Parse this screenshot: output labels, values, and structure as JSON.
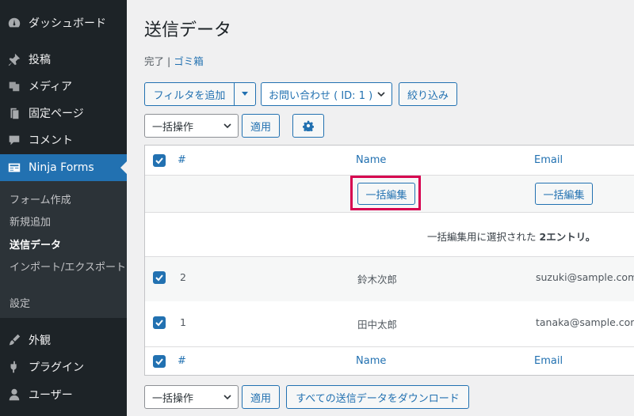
{
  "sidebar": {
    "items_top": [
      {
        "label": "ダッシュボード",
        "icon": "dashboard-icon"
      }
    ],
    "items": [
      {
        "label": "投稿",
        "icon": "pin-icon"
      },
      {
        "label": "メディア",
        "icon": "media-icon"
      },
      {
        "label": "固定ページ",
        "icon": "page-icon"
      },
      {
        "label": "コメント",
        "icon": "comment-icon"
      },
      {
        "label": "Ninja Forms",
        "icon": "forms-icon"
      }
    ],
    "submenu": [
      {
        "label": "フォーム作成"
      },
      {
        "label": "新規追加"
      },
      {
        "label": "送信データ"
      },
      {
        "label": "インポート/エクスポート"
      },
      {
        "label": "設定"
      }
    ],
    "items_bottom": [
      {
        "label": "外観",
        "icon": "brush-icon"
      },
      {
        "label": "プラグイン",
        "icon": "plugin-icon"
      },
      {
        "label": "ユーザー",
        "icon": "user-icon"
      }
    ]
  },
  "page": {
    "title": "送信データ",
    "status_done": "完了",
    "separator": "|",
    "status_trash": "ゴミ箱"
  },
  "filters": {
    "add_filter": "フィルタを追加",
    "form_select": "お問い合わせ ( ID: 1 )",
    "filter_button": "絞り込み",
    "bulk_select": "一括操作",
    "apply_button": "適用"
  },
  "table": {
    "headers": {
      "num": "#",
      "name": "Name",
      "email": "Email"
    },
    "bulk_edit_label": "一括編集",
    "selection_message": "一括編集用に選択された",
    "selection_count": "2エントリ。",
    "rows": [
      {
        "num": "2",
        "name": "鈴木次郎",
        "email": "suzuki@sample.com"
      },
      {
        "num": "1",
        "name": "田中太郎",
        "email": "tanaka@sample.com"
      }
    ]
  },
  "footer": {
    "bulk_select": "一括操作",
    "apply_button": "適用",
    "download_button": "すべての送信データをダウンロード"
  },
  "colors": {
    "accent": "#2271b1",
    "sidebar_bg": "#1d2327",
    "highlight": "#d6004f"
  }
}
